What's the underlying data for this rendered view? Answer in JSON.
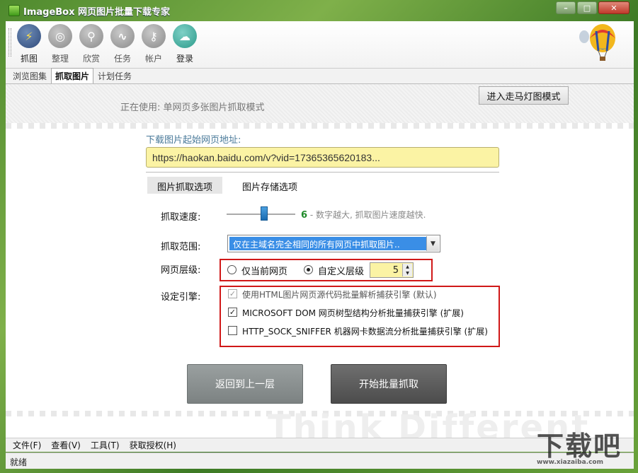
{
  "window": {
    "title": "ImageBox 网页图片批量下载专家",
    "buttons": [
      "–",
      "□",
      "✕"
    ]
  },
  "toolbar": {
    "items": [
      {
        "label": "抓图",
        "icon": "lightning-icon"
      },
      {
        "label": "整理",
        "icon": "target-icon"
      },
      {
        "label": "欣赏",
        "icon": "magnifier-icon"
      },
      {
        "label": "任务",
        "icon": "pulse-icon"
      },
      {
        "label": "帐户",
        "icon": "key-icon"
      },
      {
        "label": "登录",
        "icon": "cloud-upload-icon"
      }
    ]
  },
  "tabs": [
    {
      "label": "浏览图集"
    },
    {
      "label": "抓取图片",
      "active": true
    },
    {
      "label": "计划任务"
    }
  ],
  "header": {
    "using_text": "正在使用: 单网页多张图片抓取模式",
    "marquee_button": "进入走马灯图模式"
  },
  "form": {
    "url_label": "下载图片起始网页地址:",
    "url_value": "https://haokan.baidu.com/v?vid=17365365620183...",
    "subtabs": [
      "图片抓取选项",
      "图片存储选项"
    ],
    "speed": {
      "label": "抓取速度:",
      "value": "6",
      "hint": "- 数字越大, 抓取图片速度越快.",
      "level": 6
    },
    "range": {
      "label": "抓取范围:",
      "selected": "仅在主域名完全相同的所有网页中抓取图片.."
    },
    "depth": {
      "label": "网页层级:",
      "option_current": "仅当前网页",
      "option_custom": "自定义层级",
      "custom_value": "5",
      "selected": "custom"
    },
    "engine": {
      "label": "设定引擎:",
      "options": [
        {
          "label": "使用HTML图片网页源代码批量解析捕获引擎 (默认)",
          "checked": true,
          "disabled": true
        },
        {
          "label": "MICROSOFT DOM 网页树型结构分析批量捕获引擎 (扩展)",
          "checked": true,
          "disabled": false
        },
        {
          "label": "HTTP_SOCK_SNIFFER 机器网卡数据流分析批量捕获引擎 (扩展)",
          "checked": false,
          "disabled": false
        }
      ]
    },
    "back_button": "返回到上一层",
    "start_button": "开始批量抓取"
  },
  "background_text": "Think Different",
  "menubar": [
    "文件(F)",
    "查看(V)",
    "工具(T)",
    "获取授权(H)"
  ],
  "status": "就绪",
  "watermark": {
    "main": "下载吧",
    "sub": "www.xiazaiba.com"
  }
}
